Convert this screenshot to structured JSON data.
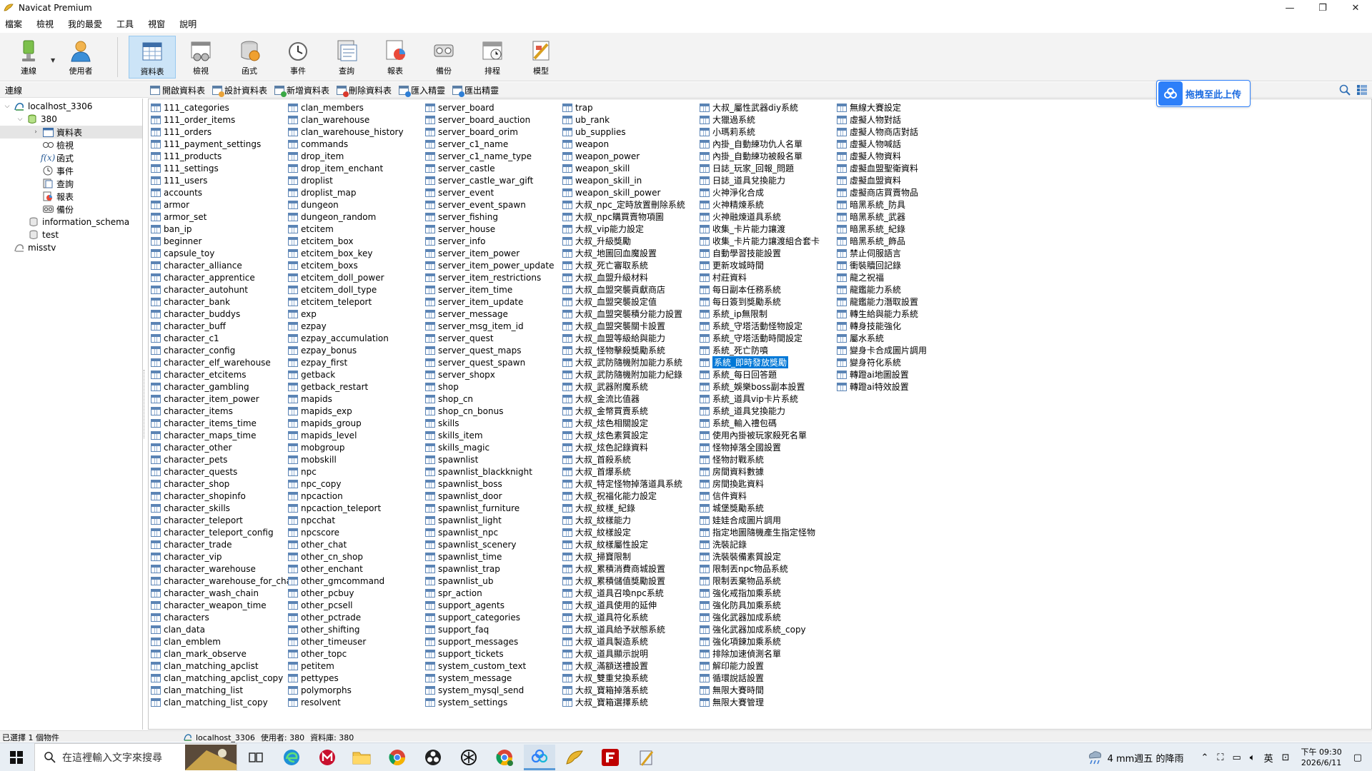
{
  "window": {
    "title": "Navicat Premium",
    "controls": {
      "minimize": "—",
      "maximize": "❐",
      "close": "✕"
    }
  },
  "menu": [
    "檔案",
    "檢視",
    "我的最愛",
    "工具",
    "視窗",
    "說明"
  ],
  "toolbar": {
    "buttons": [
      {
        "label": "連線",
        "icon": "connection-icon"
      },
      {
        "label": "使用者",
        "icon": "user-icon"
      },
      {
        "label": "資料表",
        "icon": "table-icon",
        "active": true
      },
      {
        "label": "檢視",
        "icon": "view-icon"
      },
      {
        "label": "函式",
        "icon": "function-icon"
      },
      {
        "label": "事件",
        "icon": "event-icon"
      },
      {
        "label": "查詢",
        "icon": "query-icon"
      },
      {
        "label": "報表",
        "icon": "report-icon"
      },
      {
        "label": "備份",
        "icon": "backup-icon"
      },
      {
        "label": "排程",
        "icon": "schedule-icon"
      },
      {
        "label": "模型",
        "icon": "model-icon"
      }
    ]
  },
  "panel": {
    "label": "連線"
  },
  "object_toolbar": [
    {
      "label": "開啟資料表",
      "icon": "open-table-icon"
    },
    {
      "label": "設計資料表",
      "icon": "design-table-icon"
    },
    {
      "label": "新增資料表",
      "icon": "new-table-icon"
    },
    {
      "label": "刪除資料表",
      "icon": "delete-table-icon"
    },
    {
      "label": "匯入精靈",
      "icon": "import-wizard-icon"
    },
    {
      "label": "匯出精靈",
      "icon": "export-wizard-icon"
    }
  ],
  "upload_badge": {
    "label": "拖拽至此上传"
  },
  "tree": {
    "connection": "localhost_3306",
    "database": "380",
    "nodes": [
      {
        "label": "資料表",
        "icon": "tables-folder-icon",
        "selected": true
      },
      {
        "label": "檢視",
        "icon": "views-icon"
      },
      {
        "label": "函式",
        "icon": "functions-icon"
      },
      {
        "label": "事件",
        "icon": "events-icon"
      },
      {
        "label": "查詢",
        "icon": "queries-icon"
      },
      {
        "label": "報表",
        "icon": "reports-icon"
      },
      {
        "label": "備份",
        "icon": "backups-icon"
      }
    ],
    "other_databases": [
      "information_schema",
      "test"
    ],
    "other_connection": "misstv"
  },
  "tables": {
    "columns": [
      [
        "111_categories",
        "111_order_items",
        "111_orders",
        "111_payment_settings",
        "111_products",
        "111_settings",
        "111_users",
        "accounts",
        "armor",
        "armor_set",
        "ban_ip",
        "beginner",
        "capsule_toy",
        "character_alliance",
        "character_apprentice",
        "character_autohunt",
        "character_bank",
        "character_buddys",
        "character_buff",
        "character_c1",
        "character_config",
        "character_elf_warehouse",
        "character_etcitems",
        "character_gambling",
        "character_item_power",
        "character_items",
        "character_items_time",
        "character_maps_time",
        "character_other",
        "character_pets",
        "character_quests",
        "character_shop",
        "character_shopinfo",
        "character_skills",
        "character_teleport",
        "character_teleport_config",
        "character_trade",
        "character_vip",
        "character_warehouse",
        "character_warehouse_for_cha",
        "character_wash_chain",
        "character_weapon_time",
        "characters",
        "clan_data",
        "clan_emblem",
        "clan_mark_observe",
        "clan_matching_apclist",
        "clan_matching_apclist_copy",
        "clan_matching_list",
        "clan_matching_list_copy"
      ],
      [
        "clan_members",
        "clan_warehouse",
        "clan_warehouse_history",
        "commands",
        "drop_item",
        "drop_item_enchant",
        "droplist",
        "droplist_map",
        "dungeon",
        "dungeon_random",
        "etcitem",
        "etcitem_box",
        "etcitem_box_key",
        "etcitem_boxs",
        "etcitem_doll_power",
        "etcitem_doll_type",
        "etcitem_teleport",
        "exp",
        "ezpay",
        "ezpay_accumulation",
        "ezpay_bonus",
        "ezpay_first",
        "getback",
        "getback_restart",
        "mapids",
        "mapids_exp",
        "mapids_group",
        "mapids_level",
        "mobgroup",
        "mobskill",
        "npc",
        "npc_copy",
        "npcaction",
        "npcaction_teleport",
        "npcchat",
        "npcscore",
        "other_chat",
        "other_cn_shop",
        "other_enchant",
        "other_gmcommand",
        "other_pcbuy",
        "other_pcsell",
        "other_pctrade",
        "other_shifting",
        "other_timeuser",
        "other_topc",
        "petitem",
        "pettypes",
        "polymorphs",
        "resolvent"
      ],
      [
        "server_board",
        "server_board_auction",
        "server_board_orim",
        "server_c1_name",
        "server_c1_name_type",
        "server_castle",
        "server_castle_war_gift",
        "server_event",
        "server_event_spawn",
        "server_fishing",
        "server_house",
        "server_info",
        "server_item_power",
        "server_item_power_update",
        "server_item_restrictions",
        "server_item_time",
        "server_item_update",
        "server_message",
        "server_msg_item_id",
        "server_quest",
        "server_quest_maps",
        "server_quest_spawn",
        "server_shopx",
        "shop",
        "shop_cn",
        "shop_cn_bonus",
        "skills",
        "skills_item",
        "skills_magic",
        "spawnlist",
        "spawnlist_blackknight",
        "spawnlist_boss",
        "spawnlist_door",
        "spawnlist_furniture",
        "spawnlist_light",
        "spawnlist_npc",
        "spawnlist_scenery",
        "spawnlist_time",
        "spawnlist_trap",
        "spawnlist_ub",
        "spr_action",
        "support_agents",
        "support_categories",
        "support_faq",
        "support_messages",
        "support_tickets",
        "system_custom_text",
        "system_message",
        "system_mysql_send",
        "system_settings"
      ],
      [
        "trap",
        "ub_rank",
        "ub_supplies",
        "weapon",
        "weapon_power",
        "weapon_skill",
        "weapon_skill_in",
        "weapon_skill_power",
        "大叔_npc_定時放置刪除系統",
        "大叔_npc購買賣物項圖",
        "大叔_vip能力設定",
        "大叔_升級獎勵",
        "大叔_地圖回血魔設置",
        "大叔_死亡審取系統",
        "大叔_血盟升級材料",
        "大叔_血盟突襲貢獻商店",
        "大叔_血盟突襲設定值",
        "大叔_血盟突襲積分能力設置",
        "大叔_血盟突襲關卡設置",
        "大叔_血盟等級給與能力",
        "大叔_怪物擊殺獎勵系統",
        "大叔_武防隨機附加能力系統",
        "大叔_武防隨機附加能力紀錄",
        "大叔_武器附魔系統",
        "大叔_金流比值器",
        "大叔_金幣買賣系統",
        "大叔_炫色相關設定",
        "大叔_炫色素質設定",
        "大叔_炫色記錄資料",
        "大叔_首殺系統",
        "大叔_首爆系統",
        "大叔_特定怪物掉落道具系統",
        "大叔_祝福化能力設定",
        "大叔_紋樣_紀錄",
        "大叔_紋樣能力",
        "大叔_紋樣設定",
        "大叔_紋樣屬性設定",
        "大叔_掃寶限制",
        "大叔_累積消費商城設置",
        "大叔_累積儲值獎勵設置",
        "大叔_道具召喚npc系統",
        "大叔_道具使用的延伸",
        "大叔_道具符化系統",
        "大叔_道具給予狀態系統",
        "大叔_道具製造系統",
        "大叔_道具顯示說明",
        "大叔_滿額送禮設置",
        "大叔_雙重兌換系統",
        "大叔_寶箱掉落系統",
        "大叔_寶箱選擇系統"
      ],
      [
        "大叔_屬性武器diy系統",
        "大獵過系統",
        "小瑪莉系統",
        "內掛_自動練功仇人名單",
        "內掛_自動練功被殺名單",
        "日誌_玩家_回報_問題",
        "日誌_道具兌換能力",
        "火神淨化合成",
        "火神精煉系統",
        "火神融煉道具系統",
        "收集_卡片能力讓渡",
        "收集_卡片能力讓渡組合套卡",
        "自動學習技能設置",
        "更新攻城時間",
        "村莊資料",
        "每日副本任務系統",
        "每日簽到獎勵系統",
        "系統_ip無限制",
        "系統_守塔活動怪物設定",
        "系統_守塔活動時間設定",
        "系統_死亡防噴",
        "系統_即時發放獎勵",
        "系統_每日回答題",
        "系統_娛樂boss副本設置",
        "系統_道具vip卡片系統",
        "系統_道具兌換能力",
        "系統_輸入禮包碼",
        "使用內掛被玩家殺死名單",
        "怪物掉落全國設置",
        "怪物討戰系統",
        "房間資料數據",
        "房間換匙資料",
        "信件資料",
        "城堡獎勵系統",
        "娃娃合成圖片調用",
        "指定地圖隨機產生指定怪物",
        "洗裝記錄",
        "洗裝裝備素質設定",
        "限制丟npc物品系統",
        "限制丟棄物品系統",
        "強化戒指加乘系統",
        "強化防具加乘系統",
        "強化武器加成系統",
        "強化武器加成系統_copy",
        "強化項鍊加乘系統",
        "排除加速偵測名單",
        "解印能力設置",
        "循環說話設置",
        "無限大賽時間",
        "無限大賽管理"
      ],
      [
        "無線大賽設定",
        "虛擬人物對話",
        "虛擬人物商店對話",
        "虛擬人物喊話",
        "虛擬人物資料",
        "虛擬血盟聖衛資料",
        "虛擬血盟資料",
        "虛擬商店買賣物品",
        "暗黑系統_防具",
        "暗黑系統_武器",
        "暗黑系統_紀錄",
        "暗黑系統_飾品",
        "禁止伺服語言",
        "衝裝贖回記錄",
        "龍之祝福",
        "龍鑑能力系統",
        "龍鑑能力潛取設置",
        "轉生給與能力系統",
        "轉身技能強化",
        "屬水系統",
        "變身卡合成圖片調用",
        "變身符化系統",
        "轉蹬ai地圖設置",
        "轉蹬ai特效設置"
      ]
    ],
    "selected": "系統_即時發放獎勵"
  },
  "status": {
    "left": "已選擇 1 個物件",
    "connection": "localhost_3306",
    "user": "使用者: 380",
    "database": "資料庫: 380"
  },
  "taskbar": {
    "search_placeholder": "在這裡輸入文字來搜尋",
    "weather": "4 mm週五 的降雨",
    "ime": "英",
    "time": "下午 09:30",
    "date": "2026/6/11"
  },
  "colors": {
    "selection": "#0078d7",
    "accent": "#2d7ff9",
    "toolbar_active": "#cce4f7"
  }
}
